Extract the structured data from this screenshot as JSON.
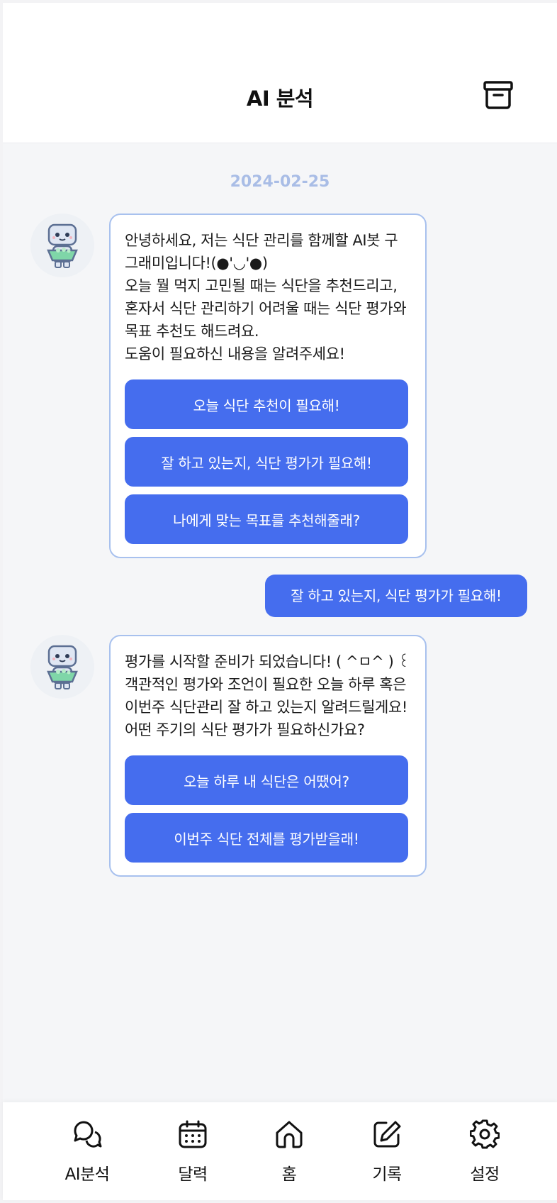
{
  "header": {
    "title": "AI 분석",
    "archive_icon": "archive-box-icon"
  },
  "chat": {
    "date": "2024-02-25",
    "messages": [
      {
        "from": "bot",
        "text": "안녕하세요, 저는 식단 관리를 함께할 AI봇 구\n그래미입니다!(●'◡'●)\n오늘 뭘 먹지 고민될 때는 식단을 추천드리고,\n혼자서 식단 관리하기 어려울 때는 식단 평가와\n목표 추천도 해드려요.\n도움이 필요하신 내용을 알려주세요!",
        "options": [
          "오늘 식단 추천이 필요해!",
          "잘 하고 있는지, 식단 평가가 필요해!",
          "나에게 맞는 목표를 추천해줄래?"
        ]
      },
      {
        "from": "user",
        "text": "잘 하고 있는지, 식단 평가가 필요해!"
      },
      {
        "from": "bot",
        "text": "평가를 시작할 준비가 되었습니다! ( ^ㅁ^ ) ꒰\n객관적인 평가와 조언이 필요한 오늘 하루 혹은\n이번주 식단관리 잘 하고 있는지 알려드릴게요!\n어떤 주기의 식단 평가가 필요하신가요?",
        "options": [
          "오늘 하루 내 식단은 어땠어?",
          "이번주 식단 전체를 평가받을래!"
        ]
      }
    ]
  },
  "tabbar": {
    "items": [
      {
        "label": "AI분석",
        "icon": "chat-bubbles-icon"
      },
      {
        "label": "달력",
        "icon": "calendar-icon"
      },
      {
        "label": "홈",
        "icon": "home-icon"
      },
      {
        "label": "기록",
        "icon": "edit-icon"
      },
      {
        "label": "설정",
        "icon": "gear-icon"
      }
    ]
  },
  "colors": {
    "primary": "#456dee",
    "bubble_border": "#a8c1ee",
    "date": "#a9bde6"
  }
}
